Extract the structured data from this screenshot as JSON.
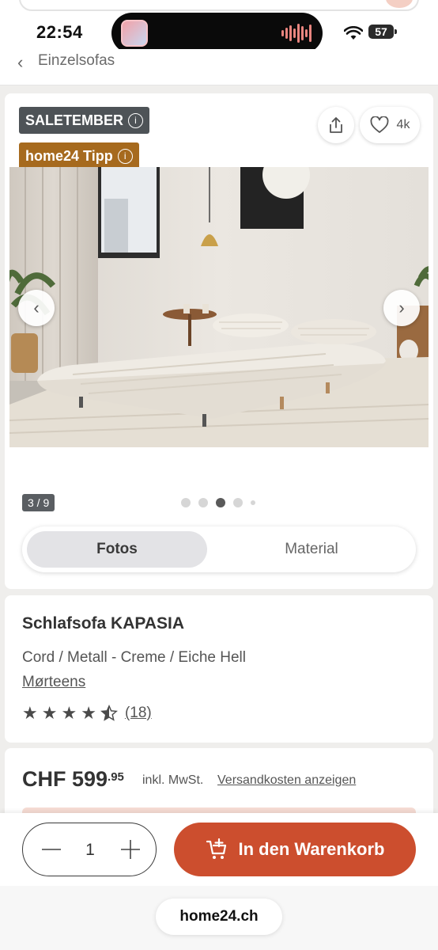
{
  "status_bar": {
    "time": "22:54",
    "battery": "57"
  },
  "nav": {
    "back_icon": "chevron-left-icon",
    "breadcrumb": "Einzelsofas"
  },
  "badges": {
    "sale": "SALETEMBER",
    "tipp": "home24 Tipp"
  },
  "actions": {
    "share_icon": "share-icon",
    "favorite_icon": "heart-icon",
    "favorite_count": "4k"
  },
  "gallery": {
    "counter": "3 / 9",
    "current_index": 3,
    "total_dots": 5
  },
  "tabs": [
    {
      "label": "Fotos",
      "active": true
    },
    {
      "label": "Material",
      "active": false
    }
  ],
  "product": {
    "title": "Schlafsofa KAPASIA",
    "variant": "Cord / Metall - Creme / Eiche Hell",
    "brand": "Mørteens",
    "rating_stars": 4.5,
    "rating_count": "(18)"
  },
  "price": {
    "currency": "CHF",
    "amount": "CHF 599",
    "cents": ".95",
    "vat": "inkl. MwSt.",
    "shipping_link": "Versandkosten anzeigen"
  },
  "cart": {
    "quantity": "1",
    "button_label": "In den Warenkorb"
  },
  "browser": {
    "url": "home24.ch"
  },
  "colors": {
    "accent": "#cc4e2e",
    "sale_badge": "#4e5357",
    "tipp_badge": "#a66a1e"
  }
}
